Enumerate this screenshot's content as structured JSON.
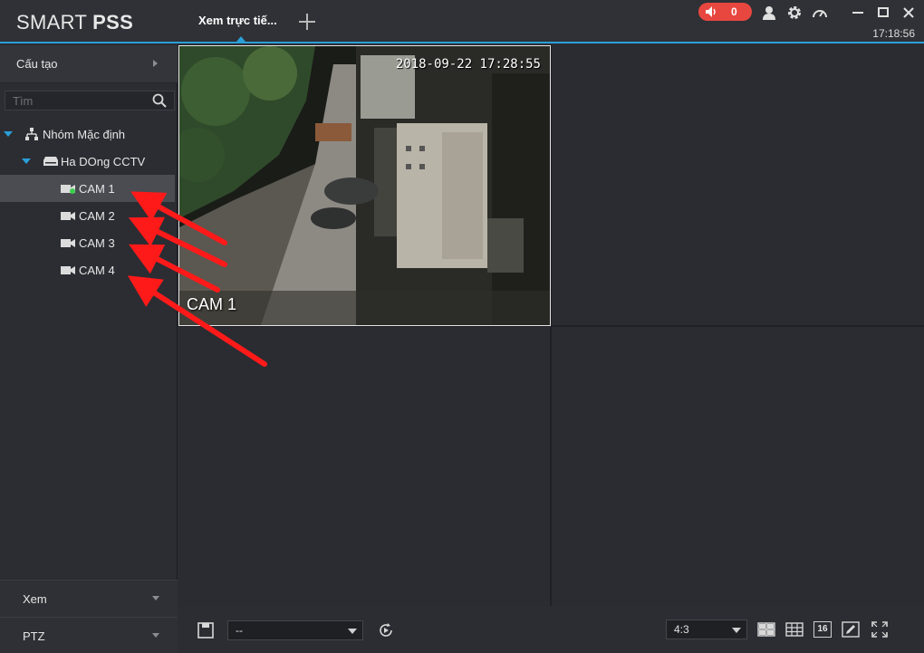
{
  "app": {
    "logo_regular": "SMART ",
    "logo_bold": "PSS",
    "clock": "17:18:56",
    "alarm_count": "0"
  },
  "tabs": [
    {
      "label": "Xem trực tiế..."
    }
  ],
  "sidebar": {
    "header": "Cấu tạo",
    "search_placeholder": "Tìm",
    "tree": {
      "group": "Nhóm Mặc định",
      "device": "Ha DOng CCTV",
      "cameras": [
        "CAM 1",
        "CAM 2",
        "CAM 3",
        "CAM 4"
      ]
    },
    "bottom": [
      {
        "label": "Xem"
      },
      {
        "label": "PTZ"
      }
    ]
  },
  "video": {
    "timestamp": "2018-09-22 17:28:55",
    "channel_name": "CAM 1"
  },
  "toolbar": {
    "view_select": "--",
    "aspect_ratio": "4:3",
    "layout_16_label": "16"
  },
  "colors": {
    "accent": "#2a9fd8",
    "alarm": "#e8473f",
    "online": "#3ccf4e",
    "annotation_arrow": "#ff1a1a"
  }
}
